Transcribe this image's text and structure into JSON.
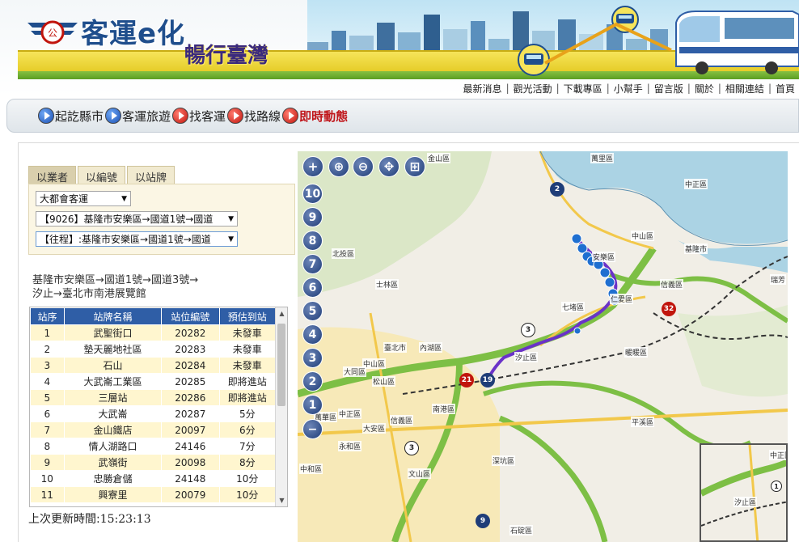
{
  "header": {
    "title": "客運e化",
    "slogan": "暢行臺灣",
    "links": [
      "最新消息",
      "觀光活動",
      "下載專區",
      "小幫手",
      "留言版",
      "關於",
      "相關連結",
      "首頁"
    ]
  },
  "nav": {
    "items": [
      {
        "label": "起訖縣市",
        "color": "blue"
      },
      {
        "label": "客運旅遊",
        "color": "blue"
      },
      {
        "label": "找客運",
        "color": "red"
      },
      {
        "label": "找路線",
        "color": "red"
      },
      {
        "label": "即時動態",
        "color": "red",
        "highlight": true
      }
    ]
  },
  "query": {
    "tabs": [
      {
        "label": "以業者",
        "active": true
      },
      {
        "label": "以編號",
        "active": false
      },
      {
        "label": "以站牌",
        "active": false
      }
    ],
    "operator": "大都會客運",
    "route": "【9026】基隆市安樂區→國道1號→國道",
    "direction": "【往程】:基隆市安樂區→國道1號→國道"
  },
  "route_description": {
    "line1": "基隆市安樂區→國道1號→國道3號→",
    "line2": "汐止→臺北市南港展覽館"
  },
  "stops_table": {
    "headers": [
      "站序",
      "站牌名稱",
      "站位編號",
      "預估到站"
    ],
    "rows": [
      [
        "1",
        "武聖街口",
        "20282",
        "未發車"
      ],
      [
        "2",
        "墊天麗地社區",
        "20283",
        "未發車"
      ],
      [
        "3",
        "石山",
        "20284",
        "未發車"
      ],
      [
        "4",
        "大武崙工業區",
        "20285",
        "即將進站"
      ],
      [
        "5",
        "三層站",
        "20286",
        "即將進站"
      ],
      [
        "6",
        "大武崙",
        "20287",
        "5分"
      ],
      [
        "7",
        "金山鐵店",
        "20097",
        "6分"
      ],
      [
        "8",
        "情人湖路口",
        "24146",
        "7分"
      ],
      [
        "9",
        "武嶺街",
        "20098",
        "8分"
      ],
      [
        "10",
        "忠勝倉儲",
        "24148",
        "10分"
      ],
      [
        "11",
        "興寮里",
        "20079",
        "10分"
      ]
    ]
  },
  "update": {
    "label": "上次更新時間:",
    "time": "15:23:13"
  },
  "map": {
    "zoom_levels": [
      "10",
      "9",
      "8",
      "7",
      "6",
      "5",
      "4",
      "3",
      "2",
      "1"
    ],
    "labels": [
      "金山區",
      "萬里區",
      "中正區",
      "北投區",
      "中山區",
      "基隆市",
      "士林區",
      "信義區",
      "安樂區",
      "仁愛區",
      "七堵區",
      "內湖區",
      "臺北市",
      "中山區",
      "汐止區",
      "暖暖區",
      "大同區",
      "松山區",
      "南港區",
      "萬華區",
      "信義區",
      "中正區",
      "大安區",
      "平溪區",
      "永和區",
      "中和區",
      "文山區",
      "深坑區",
      "石碇區",
      "瑞芳",
      "汐止區",
      "中正區"
    ],
    "shields": [
      "2",
      "32",
      "3",
      "21",
      "19",
      "3",
      "9",
      "1"
    ],
    "route_color": "#6a32c8",
    "highway_color": "#7dbf45"
  }
}
